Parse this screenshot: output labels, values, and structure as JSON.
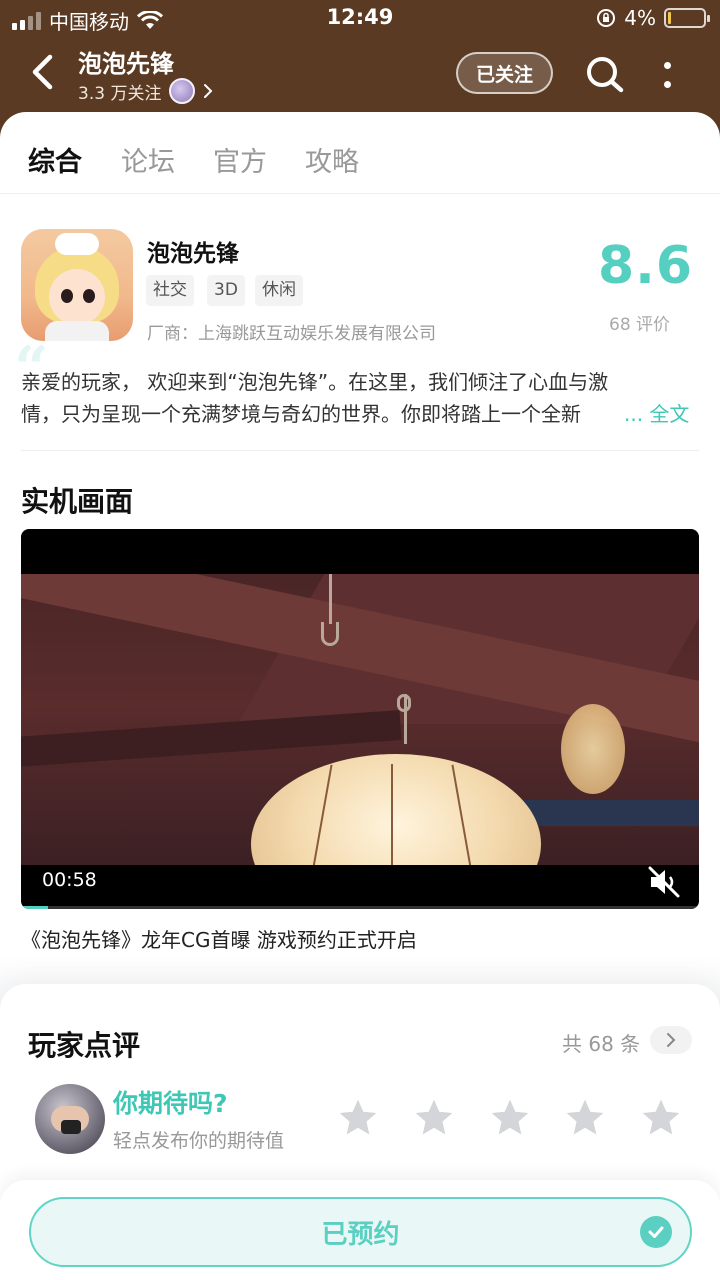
{
  "status_bar": {
    "carrier": "中国移动",
    "time": "12:49",
    "battery": "4%"
  },
  "header": {
    "title": "泡泡先锋",
    "followers": "3.3 万关注",
    "follow_button": "已关注"
  },
  "tabs": [
    {
      "label": "综合",
      "active": true
    },
    {
      "label": "论坛",
      "active": false
    },
    {
      "label": "官方",
      "active": false
    },
    {
      "label": "攻略",
      "active": false
    }
  ],
  "game": {
    "name": "泡泡先锋",
    "tags": [
      "社交",
      "3D",
      "休闲"
    ],
    "vendor": "厂商：上海跳跃互动娱乐发展有限公司",
    "score": "8.6",
    "score_count": "68 评价",
    "quote_mark": "“",
    "description_line1": "亲爱的玩家，   欢迎来到“泡泡先锋”。在这里，我们倾注了心血与激",
    "description_line2": "情，只为呈现一个充满梦境与奇幻的世界。你即将踏上一个全新",
    "read_more": "... 全文"
  },
  "screenshots_section": {
    "title": "实机画面",
    "video_time": "00:58",
    "video_progress": 0.04,
    "caption": "《泡泡先锋》龙年CG首曝 游戏预约正式开启"
  },
  "reviews": {
    "title": "玩家点评",
    "count": "共 68 条",
    "prompt_title": "你期待吗?",
    "prompt_sub": "轻点发布你的期待值",
    "stars": 5
  },
  "bottom": {
    "reserve_label": "已预约"
  },
  "colors": {
    "accent": "#55cfc0",
    "header_bg": "#5a3a22"
  }
}
